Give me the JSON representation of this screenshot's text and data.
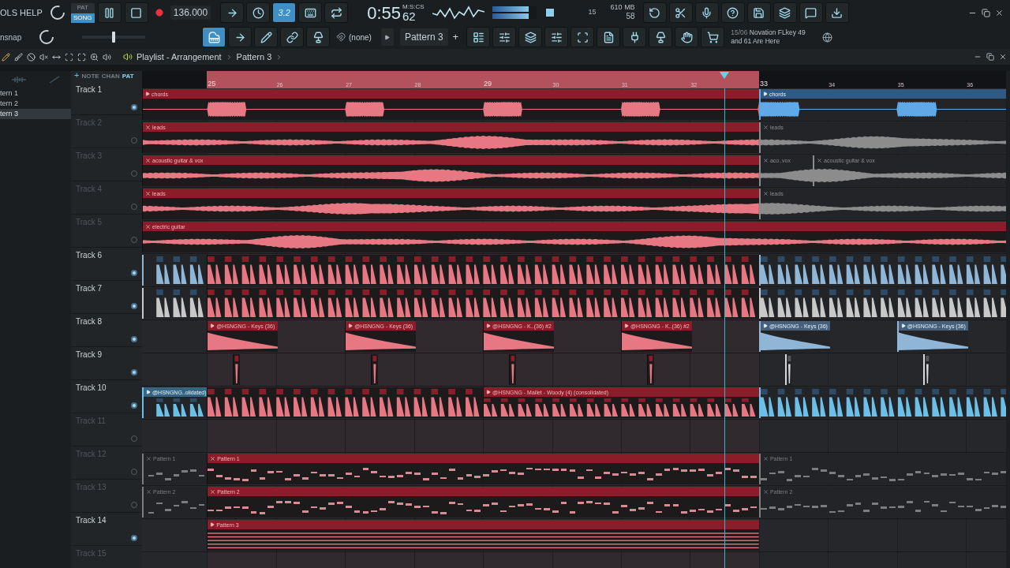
{
  "menu": {
    "text": "OLS HELP"
  },
  "transport": {
    "modes": [
      {
        "label": "PAT",
        "selected": false
      },
      {
        "label": "SONG",
        "selected": true
      }
    ],
    "tempo": "136.000"
  },
  "tools_row1": [
    {
      "selected": false
    },
    {
      "selected": false
    },
    {
      "selected": true,
      "label": "3.2"
    },
    {
      "selected": false
    },
    {
      "selected": false
    }
  ],
  "clock": {
    "time": "0:55",
    "centis": "62",
    "format": "M:S:CS"
  },
  "output_meter": {
    "level": 0.82
  },
  "stats": {
    "cpu": "15",
    "memory": "610 MB",
    "polyphony": "58"
  },
  "snap": {
    "label": "nsnap"
  },
  "pitch": {
    "level": 0.5
  },
  "tools_row2": [
    {
      "selected": true
    },
    {
      "selected": false
    },
    {
      "selected": false
    },
    {
      "selected": false
    },
    {
      "selected": false
    }
  ],
  "channel": {
    "value": "(none)"
  },
  "pattern": {
    "value": "Pattern 3",
    "add": "+"
  },
  "news": {
    "date": "15/06",
    "headline": "Novation FLkey 49 and 61 Are Here"
  },
  "playlist": {
    "title": "Playlist - Arrangement",
    "pattern": "Pattern 3"
  },
  "picker": {
    "add": "+",
    "tabs": [
      {
        "label": "NOTE",
        "selected": false
      },
      {
        "label": "CHAN",
        "selected": false
      },
      {
        "label": "PAT",
        "selected": true
      }
    ],
    "items": [
      {
        "label": "tern 1",
        "selected": false
      },
      {
        "label": "tern 2",
        "selected": false
      },
      {
        "label": "tern 3",
        "selected": true
      }
    ]
  },
  "ruler": {
    "bars": [
      {
        "label": "25",
        "selected": true
      },
      {
        "label": "26",
        "selected": true
      },
      {
        "label": "27",
        "selected": true
      },
      {
        "label": "28",
        "selected": true
      },
      {
        "label": "29",
        "selected": true
      },
      {
        "label": "30",
        "selected": true
      },
      {
        "label": "31",
        "selected": true
      },
      {
        "label": "32",
        "selected": true
      },
      {
        "label": "33",
        "selected": false
      },
      {
        "label": "34",
        "selected": false
      },
      {
        "label": "35",
        "selected": false
      },
      {
        "label": "36",
        "selected": false
      }
    ]
  },
  "tracks": [
    {
      "name": "Track 1",
      "active": true,
      "clips": [
        {
          "kind": "audio",
          "label": "chords",
          "selected": true,
          "muted": false
        },
        {
          "kind": "audio",
          "label": "chords",
          "selected": false,
          "muted": false,
          "color": "#5fa9e8"
        }
      ]
    },
    {
      "name": "Track 2",
      "active": false,
      "clips": [
        {
          "kind": "audio",
          "label": "leads",
          "selected": true,
          "muted": true
        },
        {
          "kind": "audio",
          "label": "leads",
          "selected": false,
          "muted": true,
          "color": "#8c8c8c"
        }
      ]
    },
    {
      "name": "Track 3",
      "active": false,
      "clips": [
        {
          "kind": "audio",
          "label": "acoustic guitar & vox",
          "selected": true,
          "muted": true
        },
        {
          "kind": "audio",
          "label": "aco..vox",
          "selected": false,
          "muted": true,
          "color": "#8c8c8c"
        },
        {
          "kind": "audio",
          "label": "acoustic guitar & vox",
          "selected": false,
          "muted": true,
          "color": "#8c8c8c"
        }
      ]
    },
    {
      "name": "Track 4",
      "active": false,
      "clips": [
        {
          "kind": "audio",
          "label": "leads",
          "selected": true,
          "muted": true
        },
        {
          "kind": "audio",
          "label": "leads",
          "selected": false,
          "muted": true,
          "color": "#8c8c8c"
        }
      ]
    },
    {
      "name": "Track 5",
      "active": false,
      "clips": [
        {
          "kind": "audio",
          "label": "electric guitar",
          "selected": true,
          "muted": true
        }
      ]
    },
    {
      "name": "Track 6",
      "active": true,
      "clips": [
        {
          "kind": "chops",
          "selected": false,
          "color": "#8fb6d6"
        },
        {
          "kind": "chops",
          "selected": true
        },
        {
          "kind": "chops",
          "selected": false,
          "color": "#8fb6d6"
        }
      ]
    },
    {
      "name": "Track 7",
      "active": true,
      "clips": [
        {
          "kind": "chops",
          "selected": false,
          "color": "#c8c8c8"
        },
        {
          "kind": "chops",
          "selected": true
        },
        {
          "kind": "chops",
          "selected": false,
          "color": "#c8c8c8"
        }
      ]
    },
    {
      "name": "Track 8",
      "active": true,
      "clips": [
        {
          "kind": "keys",
          "label": "@HSNGNG - Keys (36)",
          "selected": true,
          "muted": false
        },
        {
          "kind": "keys",
          "label": "@HSNGNG - Keys (36)",
          "selected": true,
          "muted": false
        },
        {
          "kind": "keys",
          "label": "@HSNGNG - K..(36) #2",
          "selected": true,
          "muted": false
        },
        {
          "kind": "keys",
          "label": "@HSNGNG - K..(36) #2",
          "selected": true,
          "muted": false
        },
        {
          "kind": "keys",
          "label": "@HSNGNG - Keys (36)",
          "selected": false,
          "muted": false,
          "color": "#8fb6d6"
        },
        {
          "kind": "keys",
          "label": "@HSNGNG - Keys (36)",
          "selected": false,
          "muted": false,
          "color": "#8fb6d6"
        }
      ]
    },
    {
      "name": "Track 9",
      "active": true,
      "clips": [
        {
          "kind": "tick",
          "selected": true
        },
        {
          "kind": "tick",
          "selected": true
        },
        {
          "kind": "tick",
          "selected": true
        },
        {
          "kind": "tick",
          "selected": true
        },
        {
          "kind": "tick",
          "selected": false,
          "color": "#d8d8d8"
        },
        {
          "kind": "tick",
          "selected": false,
          "color": "#d8d8d8"
        }
      ]
    },
    {
      "name": "Track 10",
      "active": true,
      "clips": [
        {
          "kind": "chops",
          "label": "@HSNGNG..olidated)",
          "selected": false,
          "muted": false,
          "color": "#6cc0e8"
        },
        {
          "kind": "chops",
          "selected": true
        },
        {
          "kind": "chops",
          "label": "@HSNGNG - Mallet - Woody (4) (consolidated)",
          "selected": true,
          "muted": false
        },
        {
          "kind": "chops",
          "selected": false,
          "color": "#6cc0e8"
        }
      ]
    },
    {
      "name": "Track 11",
      "active": false
    },
    {
      "name": "Track 12",
      "active": false,
      "clips": [
        {
          "kind": "notes",
          "label": "Pattern 1",
          "selected": false,
          "muted": true,
          "color": "#7d7d7d"
        },
        {
          "kind": "notes",
          "label": "Pattern 1",
          "selected": true,
          "muted": true
        },
        {
          "kind": "notes",
          "label": "Pattern 1",
          "selected": false,
          "muted": true,
          "color": "#7d7d7d"
        }
      ]
    },
    {
      "name": "Track 13",
      "active": false,
      "clips": [
        {
          "kind": "notes",
          "label": "Pattern 2",
          "selected": false,
          "muted": true,
          "color": "#7d7d7d"
        },
        {
          "kind": "notes",
          "label": "Pattern 2",
          "selected": true,
          "muted": true
        },
        {
          "kind": "notes",
          "label": "Pattern 2",
          "selected": false,
          "muted": true,
          "color": "#7d7d7d"
        }
      ]
    },
    {
      "name": "Track 14",
      "active": true,
      "clips": [
        {
          "kind": "lines",
          "label": "Pattern 3",
          "selected": true,
          "muted": false
        }
      ]
    },
    {
      "name": "Track 15",
      "active": false
    }
  ]
}
